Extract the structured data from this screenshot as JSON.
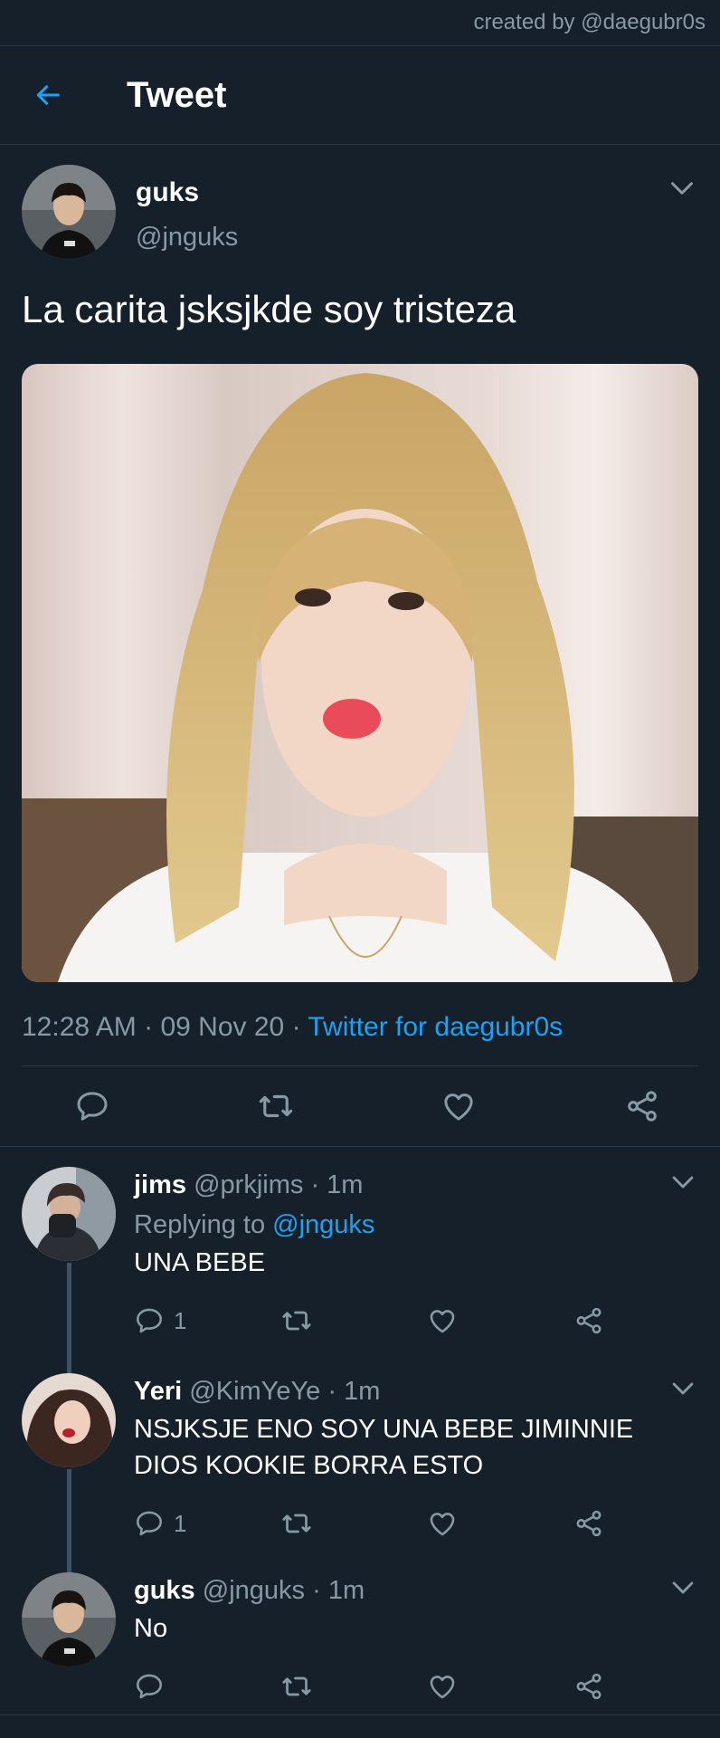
{
  "credit": "created by @daegubr0s",
  "header": {
    "title": "Tweet"
  },
  "tweet": {
    "name": "guks",
    "handle": "@jnguks",
    "text": "La carita jsksjkde soy tristeza",
    "time": "12:28 AM",
    "date": "09 Nov 20",
    "sep": "·",
    "source": "Twitter for daegubr0s"
  },
  "replies": [
    {
      "name": "jims",
      "handle": "@prkjims",
      "time": "1m",
      "replying_label": "Replying to",
      "replying_to": "@jnguks",
      "text": "UNA BEBE",
      "reply_count": "1"
    },
    {
      "name": "Yeri",
      "handle": "@KimYeYe",
      "time": "1m",
      "text": "NSJKSJE ENO SOY UNA BEBE JIMINNIE DIOS KOOKIE BORRA ESTO",
      "reply_count": "1"
    },
    {
      "name": "guks",
      "handle": "@jnguks",
      "time": "1m",
      "text": "No",
      "reply_count": ""
    }
  ],
  "colors": {
    "background": "#16202b",
    "accent": "#1da1f2",
    "muted": "#8899a6",
    "divider": "#2b3a48"
  }
}
